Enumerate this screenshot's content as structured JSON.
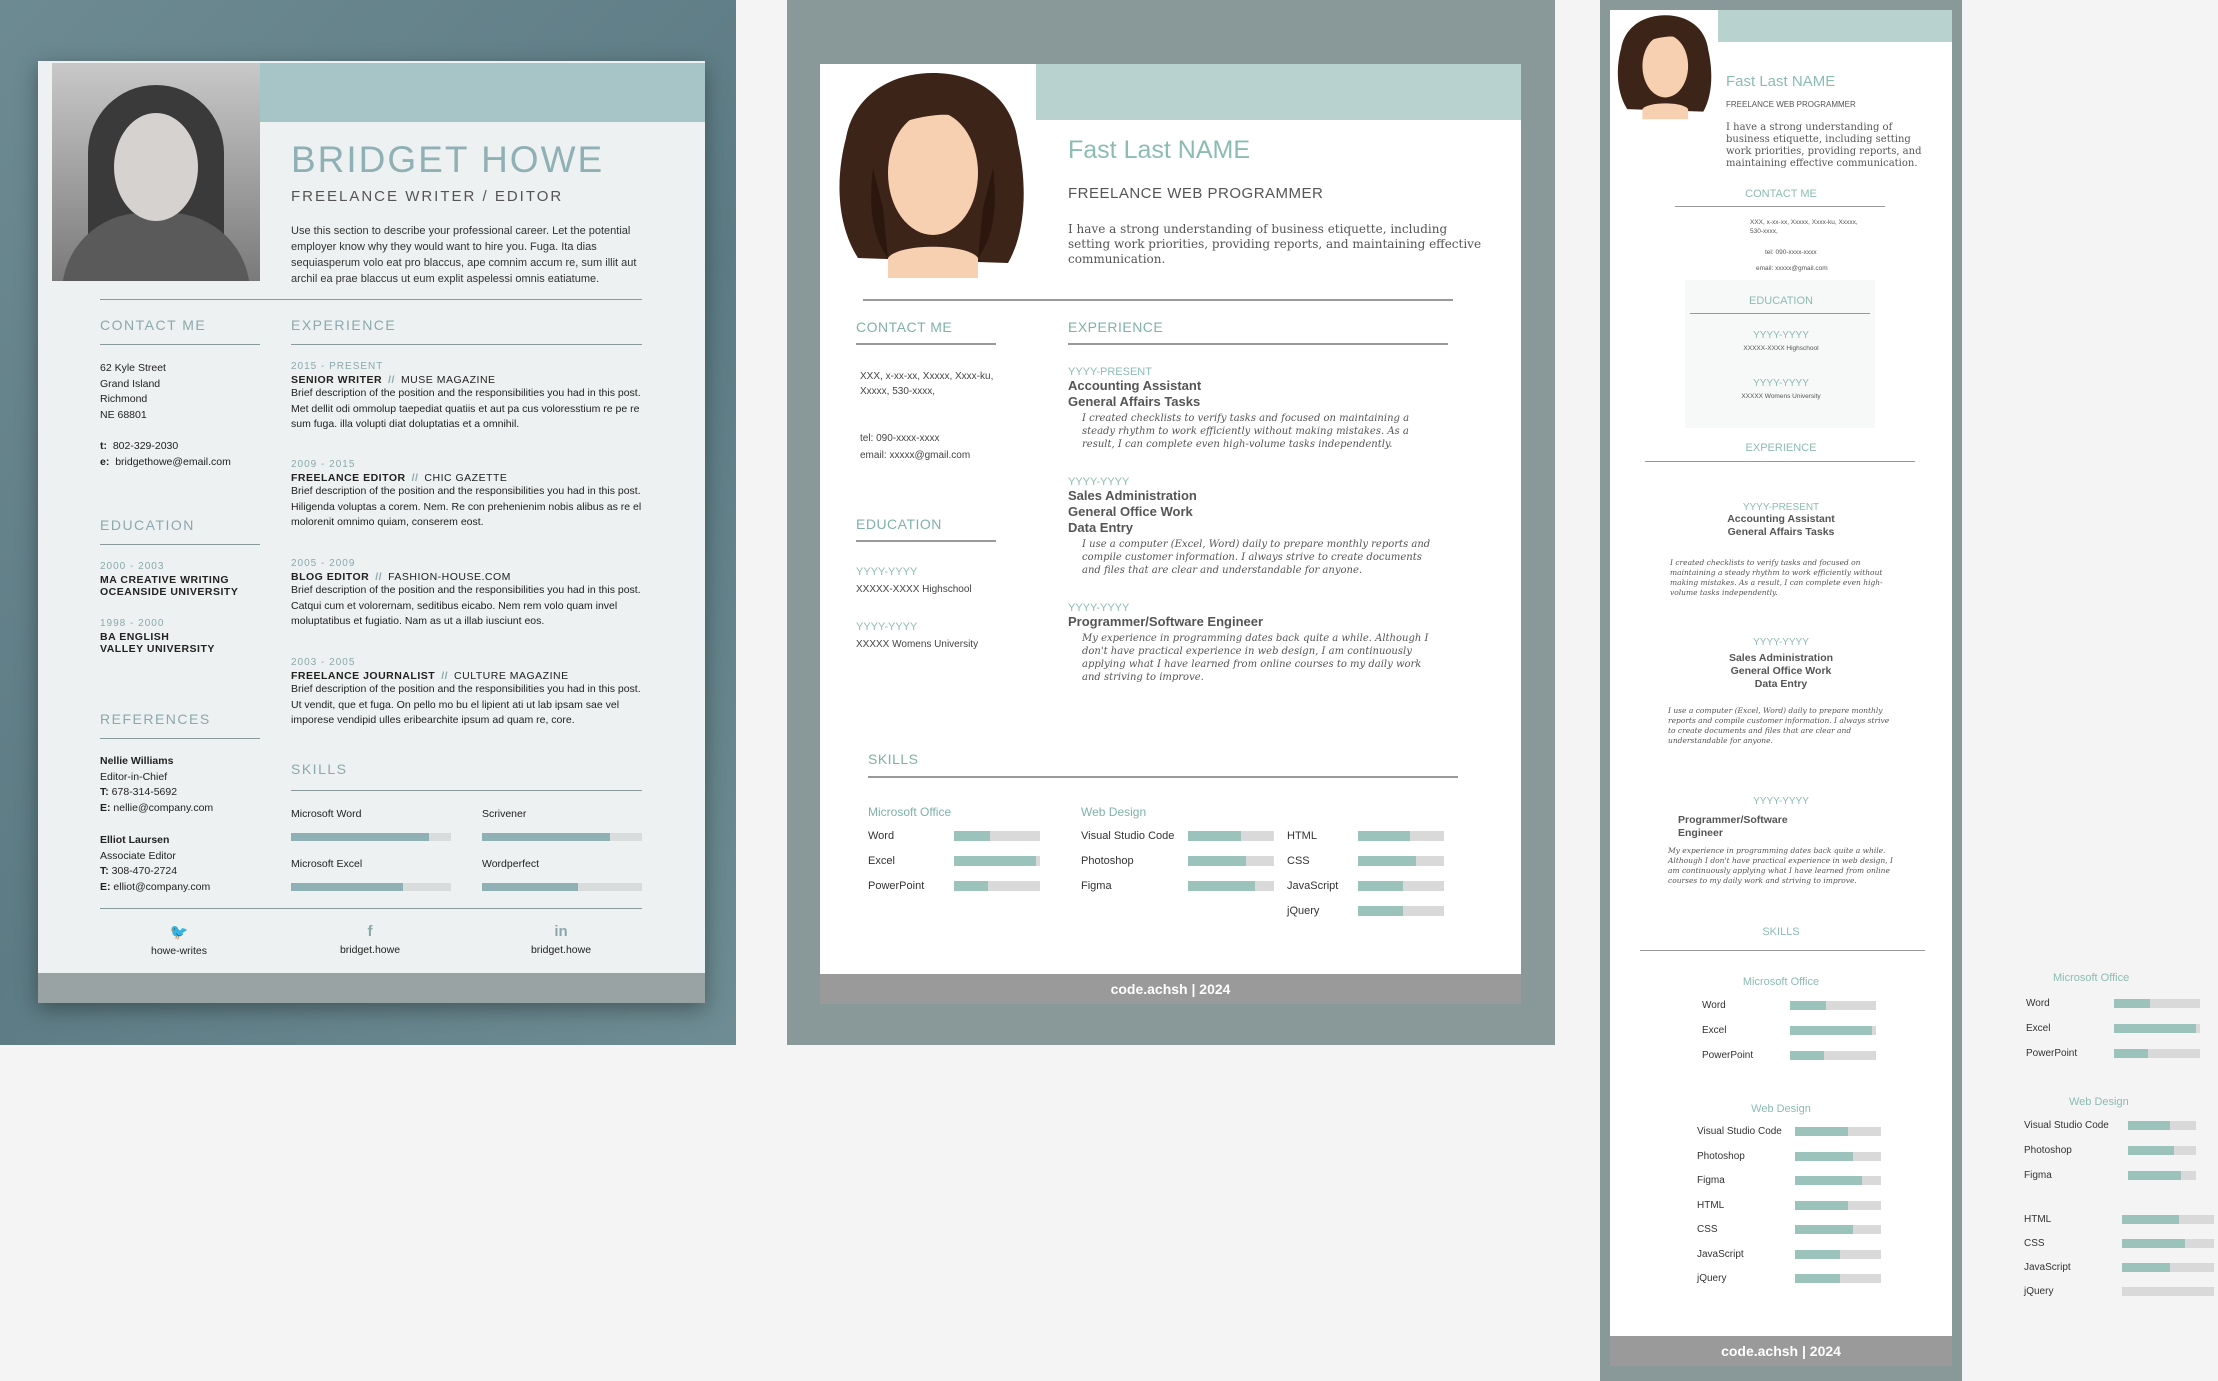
{
  "resume1": {
    "name": "BRIDGET HOWE",
    "role": "FREELANCE WRITER / EDITOR",
    "intro": "Use this section to describe your professional career. Let the potential employer know why they would want to hire you. Fuga. Ita dias sequiasperum volo eat pro blaccus, ape comnim accum re, sum illit aut archil ea prae blaccus ut eum explit aspelessi omnis eatiatume.",
    "contact_heading": "CONTACT ME",
    "address": [
      "62 Kyle Street",
      "Grand Island",
      "Richmond",
      "NE 68801"
    ],
    "phone_label": "t:",
    "phone": "802-329-2030",
    "email_label": "e:",
    "email": "bridgethowe@email.com",
    "education_heading": "EDUCATION",
    "education": [
      {
        "years": "2000 - 2003",
        "line1": "MA CREATIVE WRITING",
        "line2": "OCEANSIDE UNIVERSITY"
      },
      {
        "years": "1998 - 2000",
        "line1": "BA ENGLISH",
        "line2": "VALLEY UNIVERSITY"
      }
    ],
    "references_heading": "REFERENCES",
    "references": [
      {
        "name": "Nellie Williams",
        "title": "Editor-in-Chief",
        "t_label": "T:",
        "phone": "678-314-5692",
        "e_label": "E:",
        "email": "nellie@company.com"
      },
      {
        "name": "Elliot Laursen",
        "title": "Associate Editor",
        "t_label": "T:",
        "phone": "308-470-2724",
        "e_label": "E:",
        "email": "elliot@company.com"
      }
    ],
    "experience_heading": "EXPERIENCE",
    "experience": [
      {
        "years": "2015 - PRESENT",
        "title": "SENIOR WRITER",
        "company": "MUSE MAGAZINE",
        "desc": "Brief description of the position and the responsibilities you had in this post. Met dellit odi ommolup taepediat quatiis et aut pa cus voloresstium re pe re sum fuga. illa volupti diat doluptatias et a omnihil."
      },
      {
        "years": "2009 - 2015",
        "title": "FREELANCE EDITOR",
        "company": "CHIC GAZETTE",
        "desc": "Brief description of the position and the responsibilities you had in this post. Hiligenda voluptas a corem. Nem. Re con prehenienim nobis alibus as re el molorenit omnimo quiam, conserem eost."
      },
      {
        "years": "2005 - 2009",
        "title": "BLOG EDITOR",
        "company": "FASHION-HOUSE.COM",
        "desc": "Brief description of the position and the responsibilities you had in this post. Catqui cum et volorernam, seditibus eicabo. Nem rem volo quam invel moluptatibus et fugiatio. Nam as ut a illab iusciunt eos."
      },
      {
        "years": "2003 - 2005",
        "title": "FREELANCE JOURNALIST",
        "company": "CULTURE MAGAZINE",
        "desc": "Brief description of the position and the responsibilities you had in this post. Ut vendit, que et fuga. On pello mo bu el lipient ati ut lab ipsam sae vel imporese vendipid ulles eribearchite ipsum ad quam re, core."
      }
    ],
    "separator": "//",
    "skills_heading": "SKILLS",
    "skills": [
      {
        "name": "Microsoft Word",
        "level": 0.86
      },
      {
        "name": "Scrivener",
        "level": 0.8
      },
      {
        "name": "Microsoft Excel",
        "level": 0.7
      },
      {
        "name": "Wordperfect",
        "level": 0.6
      }
    ],
    "social": [
      {
        "icon": "twitter-icon",
        "glyph": "🐦",
        "label": "howe-writes"
      },
      {
        "icon": "facebook-icon",
        "glyph": "f",
        "label": "bridget.howe"
      },
      {
        "icon": "linkedin-icon",
        "glyph": "in",
        "label": "bridget.howe"
      }
    ]
  },
  "resume2": {
    "name": "Fast Last NAME",
    "role": "FREELANCE WEB PROGRAMMER",
    "intro": "I have a strong understanding of business etiquette, including setting work priorities, providing reports, and maintaining effective communication.",
    "contact_heading": "CONTACT ME",
    "address": "XXX, x-xx-xx, Xxxxx, Xxxx-ku, Xxxxx, 530-xxxx,",
    "tel": "tel: 090-xxxx-xxxx",
    "email": "email: xxxxx@gmail.com",
    "education_heading": "EDUCATION",
    "education": [
      {
        "years": "YYYY-YYYY",
        "school": "XXXXX-XXXX Highschool"
      },
      {
        "years": "YYYY-YYYY",
        "school": "XXXXX Womens University"
      }
    ],
    "experience_heading": "EXPERIENCE",
    "experience": [
      {
        "years": "YYYY-PRESENT",
        "titles": [
          "Accounting Assistant",
          "General Affairs Tasks"
        ],
        "desc": "I created checklists to verify tasks and focused on maintaining a steady rhythm to work efficiently without making mistakes. As a result, I can complete even high-volume tasks independently."
      },
      {
        "years": "YYYY-YYYY",
        "titles": [
          "Sales Administration",
          "General Office Work",
          "Data Entry"
        ],
        "desc": "I use a computer (Excel, Word) daily to prepare monthly reports and compile customer information. I always strive to create documents and files that are clear and understandable for anyone."
      },
      {
        "years": "YYYY-YYYY",
        "titles": [
          "Programmer/Software Engineer"
        ],
        "desc": "My experience in programming dates back quite a while. Although I don't have practical experience in web design, I am continuously applying what I have learned from online courses to my daily work and striving to improve."
      }
    ],
    "skills_heading": "SKILLS",
    "office_heading": "Microsoft Office",
    "office": [
      {
        "name": "Word",
        "level": 0.42
      },
      {
        "name": "Excel",
        "level": 0.95
      },
      {
        "name": "PowerPoint",
        "level": 0.4
      }
    ],
    "web_heading": "Web Design",
    "web_left": [
      {
        "name": "Visual Studio Code",
        "level": 0.62
      },
      {
        "name": "Photoshop",
        "level": 0.68
      },
      {
        "name": "Figma",
        "level": 0.78
      }
    ],
    "web_right": [
      {
        "name": "HTML",
        "level": 0.6
      },
      {
        "name": "CSS",
        "level": 0.68
      },
      {
        "name": "JavaScript",
        "level": 0.52
      },
      {
        "name": "jQuery",
        "level": 0.52
      }
    ],
    "footer": "code.achsh | 2024"
  },
  "resume3": {
    "name": "Fast Last NAME",
    "role": "FREELANCE WEB PROGRAMMER",
    "intro": "I have a strong understanding of business etiquette, including setting work priorities, providing reports, and maintaining effective communication.",
    "contact_heading": "CONTACT ME",
    "address": "XXX, x-xx-xx, Xxxxx, Xxxx-ku, Xxxxx, 530-xxxx,",
    "tel": "tel: 090-xxxx-xxxx",
    "email": "email: xxxxx@gmail.com",
    "education_heading": "EDUCATION",
    "education": [
      {
        "years": "YYYY-YYYY",
        "school": "XXXXX-XXXX Highschool"
      },
      {
        "years": "YYYY-YYYY",
        "school": "XXXXX Womens University"
      }
    ],
    "experience_heading": "EXPERIENCE",
    "experience": [
      {
        "years": "YYYY-PRESENT",
        "titles": [
          "Accounting Assistant",
          "General Affairs Tasks"
        ],
        "desc": "I created checklists to verify tasks and focused on maintaining a steady rhythm to work efficiently without making mistakes. As a result, I can complete even high-volume tasks independently."
      },
      {
        "years": "YYYY-YYYY",
        "titles": [
          "Sales Administration",
          "General Office Work",
          "Data Entry"
        ],
        "desc": "I use a computer (Excel, Word) daily to prepare monthly reports and compile customer information. I always strive to create documents and files that are clear and understandable for anyone."
      },
      {
        "years": "YYYY-YYYY",
        "titles": [
          "Programmer/Software",
          "Engineer"
        ],
        "desc": "My experience in programming dates back quite a while. Although I don't have practical experience in web design, I am continuously applying what I have learned from online courses to my daily work and striving to improve."
      }
    ],
    "skills_heading": "SKILLS",
    "office_heading": "Microsoft Office",
    "office": [
      {
        "name": "Word",
        "level": 0.42
      },
      {
        "name": "Excel",
        "level": 0.95
      },
      {
        "name": "PowerPoint",
        "level": 0.4
      }
    ],
    "web_heading": "Web Design",
    "web": [
      {
        "name": "Visual Studio Code",
        "level": 0.62
      },
      {
        "name": "Photoshop",
        "level": 0.68
      },
      {
        "name": "Figma",
        "level": 0.78
      },
      {
        "name": "HTML",
        "level": 0.62
      },
      {
        "name": "CSS",
        "level": 0.68
      },
      {
        "name": "JavaScript",
        "level": 0.52
      },
      {
        "name": "jQuery",
        "level": 0.52
      }
    ],
    "footer": "code.achsh | 2024"
  },
  "loose_skills": {
    "office_heading": "Microsoft Office",
    "office": [
      {
        "name": "Word",
        "level": 0.42
      },
      {
        "name": "Excel",
        "level": 0.95
      },
      {
        "name": "PowerPoint",
        "level": 0.4
      }
    ],
    "web_heading": "Web Design",
    "web": [
      {
        "name": "Visual Studio Code",
        "level": 0.62
      },
      {
        "name": "Photoshop",
        "level": 0.68
      },
      {
        "name": "Figma",
        "level": 0.78
      }
    ],
    "web2": [
      {
        "name": "HTML",
        "level": 0.62
      },
      {
        "name": "CSS",
        "level": 0.68
      },
      {
        "name": "JavaScript",
        "level": 0.52
      },
      {
        "name": "jQuery",
        "level": 0.0
      }
    ]
  }
}
